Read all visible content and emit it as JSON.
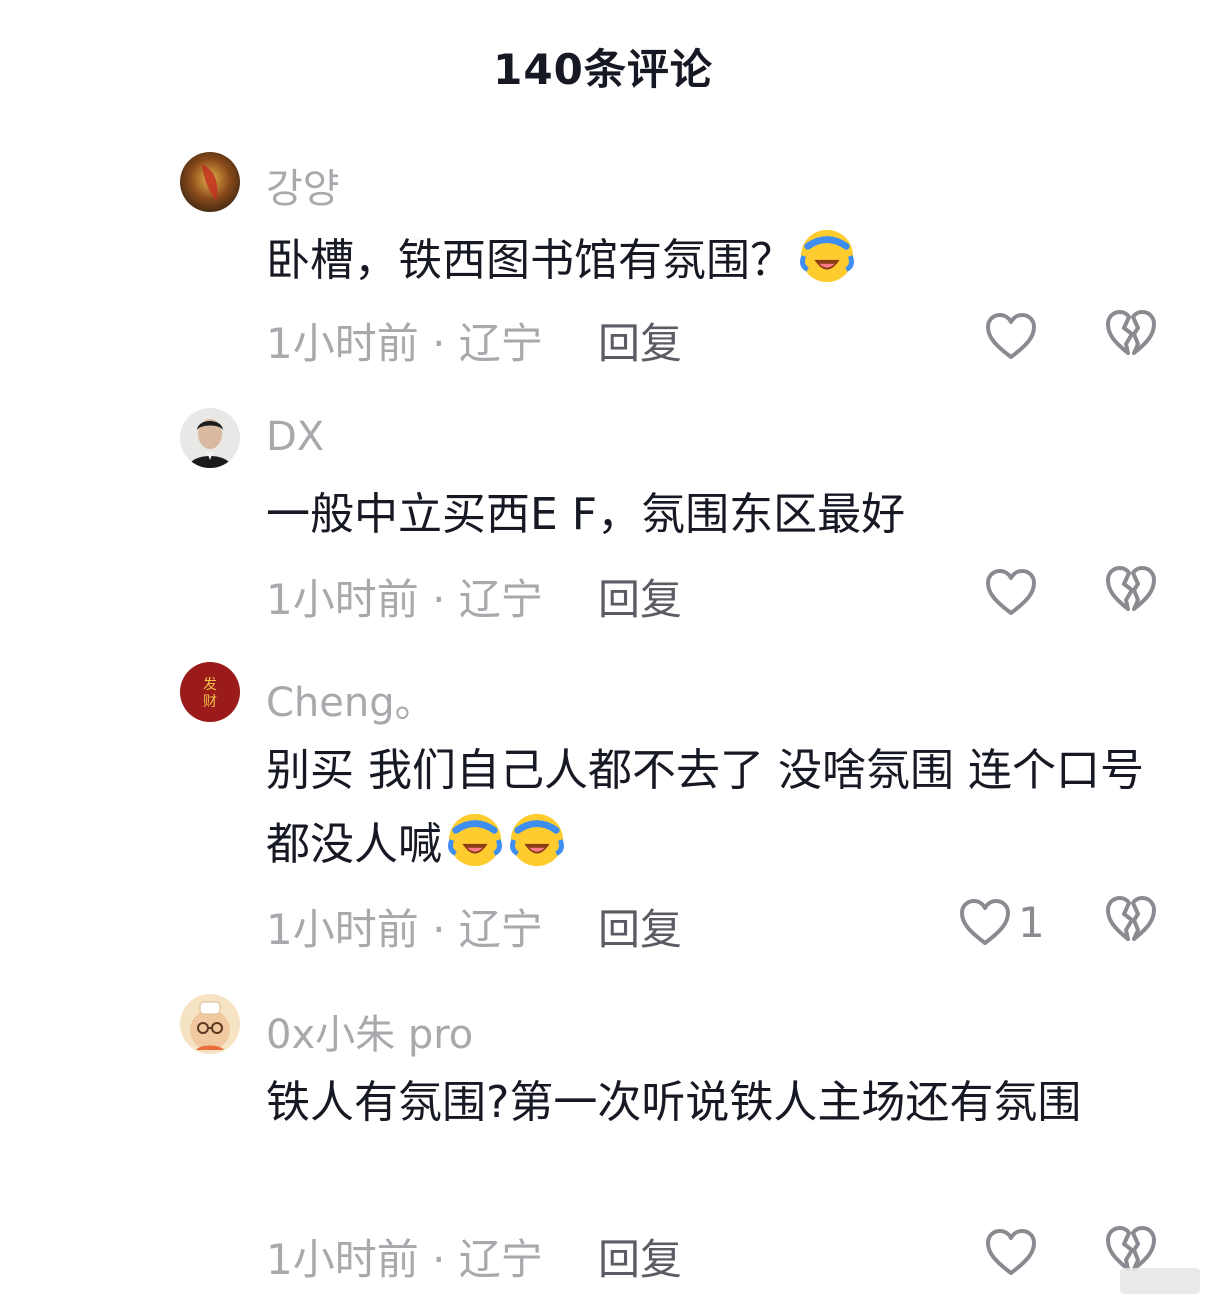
{
  "header": {
    "title": "140条评论"
  },
  "comments": [
    {
      "username": "강양",
      "text": "卧槽，铁西图书馆有氛围？",
      "emoji_count": 1,
      "meta": "1小时前 · 辽宁",
      "reply_label": "回复",
      "like_count": ""
    },
    {
      "username": "DX",
      "text": "一般中立买西E F，氛围东区最好",
      "emoji_count": 0,
      "meta": "1小时前 · 辽宁",
      "reply_label": "回复",
      "like_count": ""
    },
    {
      "username": "Cheng。",
      "text": "别买 我们自己人都不去了 没啥氛围 连个口号都没人喊",
      "emoji_count": 2,
      "meta": "1小时前 · 辽宁",
      "reply_label": "回复",
      "like_count": "1",
      "avatar_text": "发财"
    },
    {
      "username": "0x小朱 pro",
      "text": "铁人有氛围?第一次听说铁人主场还有氛围",
      "emoji_count": 0,
      "meta": "1小时前 · 辽宁",
      "reply_label": "回复",
      "like_count": ""
    }
  ],
  "icons": {
    "like": "heart-outline-icon",
    "dislike": "broken-heart-icon",
    "emoji": "laughing-crying-emoji-icon"
  },
  "colors": {
    "text_primary": "#161823",
    "text_secondary": "#a8a9ad",
    "reply": "#5b5c63",
    "icon": "#8a8b91",
    "avatar_red": "#9b1b1b"
  }
}
